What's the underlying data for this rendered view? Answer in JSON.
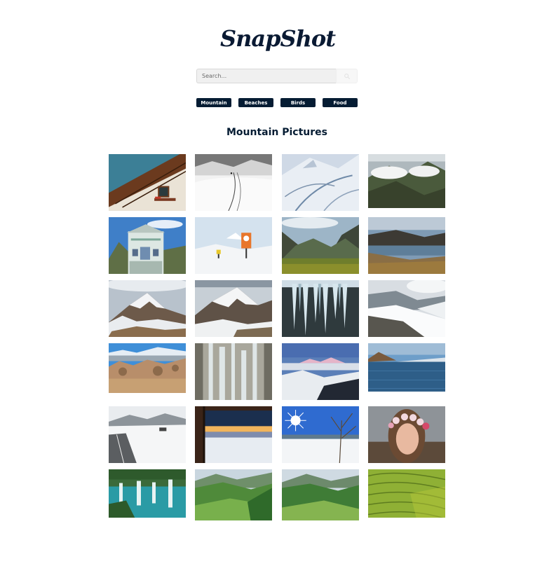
{
  "brand": {
    "logo_text": "SnapShot"
  },
  "search": {
    "placeholder": "Search...",
    "button_icon": "search-icon"
  },
  "categories": [
    {
      "label": "Mountain"
    },
    {
      "label": "Beaches"
    },
    {
      "label": "Birds"
    },
    {
      "label": "Food"
    }
  ],
  "gallery": {
    "title": "Mountain Pictures",
    "photos": [
      {
        "name": "photo-chalet-eaves",
        "scene": "chalet"
      },
      {
        "name": "photo-snow-hikers",
        "scene": "snowbw"
      },
      {
        "name": "photo-glacier-aerial",
        "scene": "glacier"
      },
      {
        "name": "photo-cloud-ridge",
        "scene": "cloudridge"
      },
      {
        "name": "photo-mountain-hotel",
        "scene": "hotel"
      },
      {
        "name": "photo-orange-sign",
        "scene": "orangesign"
      },
      {
        "name": "photo-valley-peaks",
        "scene": "valley"
      },
      {
        "name": "photo-mountain-lake",
        "scene": "lakeevening"
      },
      {
        "name": "photo-snowy-peaks-1",
        "scene": "snowpeak"
      },
      {
        "name": "photo-snowy-peaks-2",
        "scene": "snowpeak2"
      },
      {
        "name": "photo-icicles",
        "scene": "icicles"
      },
      {
        "name": "photo-snowy-slope",
        "scene": "snowslope"
      },
      {
        "name": "photo-desert-rocks",
        "scene": "desert"
      },
      {
        "name": "photo-frozen-waterfall",
        "scene": "frozenfall"
      },
      {
        "name": "photo-pink-alpenglow",
        "scene": "alpenglow"
      },
      {
        "name": "photo-blue-lake",
        "scene": "bluelake"
      },
      {
        "name": "photo-snowy-road",
        "scene": "road"
      },
      {
        "name": "photo-cabin-sunset",
        "scene": "cabin"
      },
      {
        "name": "photo-sun-snowfield",
        "scene": "sunsnow"
      },
      {
        "name": "photo-flower-crown-woman",
        "scene": "woman"
      },
      {
        "name": "photo-waterfalls",
        "scene": "waterfalls"
      },
      {
        "name": "photo-green-hills-1",
        "scene": "greenhills"
      },
      {
        "name": "photo-green-hills-2",
        "scene": "greenhills2"
      },
      {
        "name": "photo-rice-terraces",
        "scene": "terraces"
      }
    ]
  },
  "colors": {
    "primary": "#051c33",
    "search_bg": "#f0f0f0",
    "background": "#ffffff"
  }
}
